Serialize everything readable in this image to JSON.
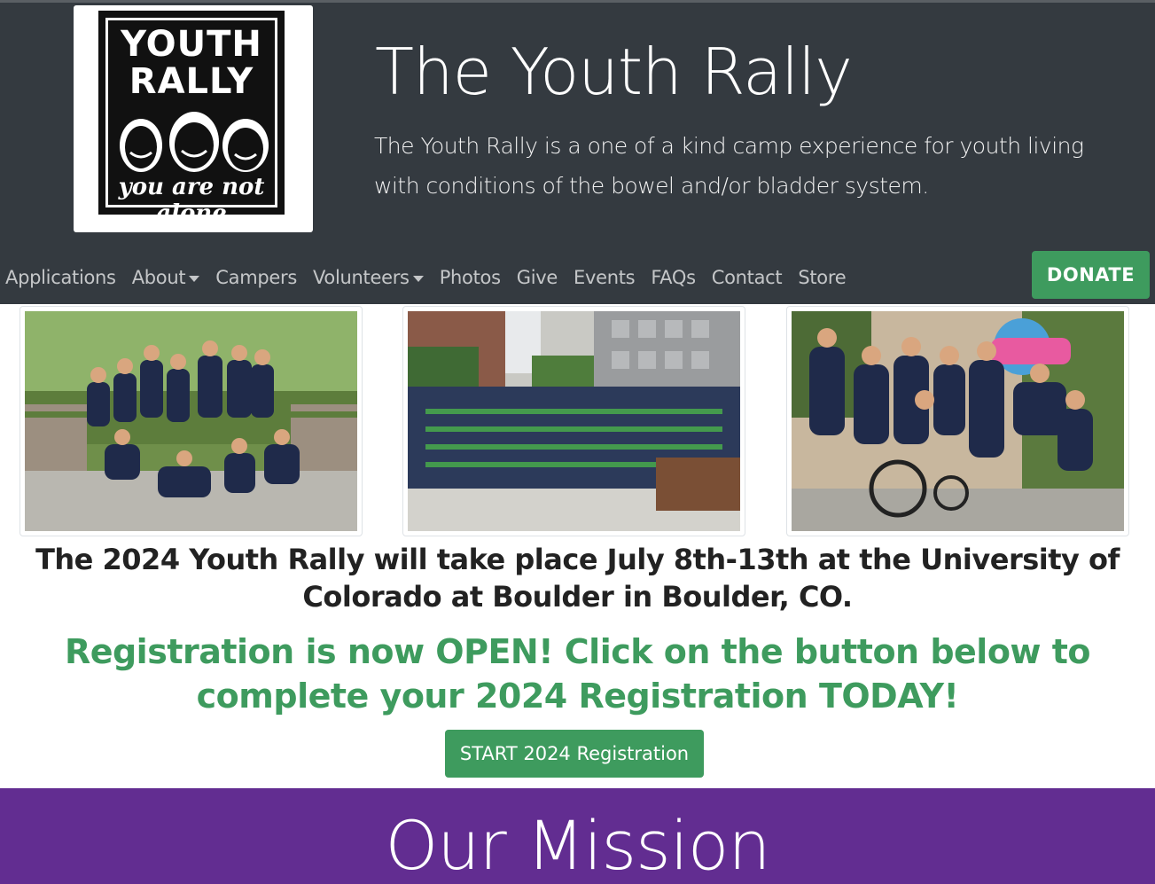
{
  "header": {
    "logo": {
      "line1": "YOUTH",
      "line2": "RALLY",
      "tagline": "you are not alone"
    },
    "title": "The Youth Rally",
    "description": "The Youth Rally is a one of a kind camp experience for youth living with conditions of the bowel and/or bladder system."
  },
  "nav": {
    "items": [
      {
        "label": "Applications"
      },
      {
        "label": "About"
      },
      {
        "label": "Campers"
      },
      {
        "label": "Volunteers"
      },
      {
        "label": "Photos"
      },
      {
        "label": "Give"
      },
      {
        "label": "Events"
      },
      {
        "label": "FAQs"
      },
      {
        "label": "Contact"
      },
      {
        "label": "Store"
      }
    ],
    "donate_label": "DONATE"
  },
  "photos": [
    {
      "name": "group-photo-outdoor"
    },
    {
      "name": "group-photo-campus"
    },
    {
      "name": "group-photo-wheelchair"
    }
  ],
  "event": {
    "text": "The 2024 Youth Rally will take place July 8th-13th at the University of Colorado at Boulder in Boulder, CO."
  },
  "registration": {
    "text": "Registration is now OPEN! Click on the button below to complete your 2024 Registration TODAY!",
    "button_label": "START 2024 Registration"
  },
  "mission": {
    "title": "Our Mission"
  },
  "colors": {
    "header_bg": "#343a40",
    "accent_green": "#3e9b5e",
    "mission_purple": "#622d91"
  }
}
